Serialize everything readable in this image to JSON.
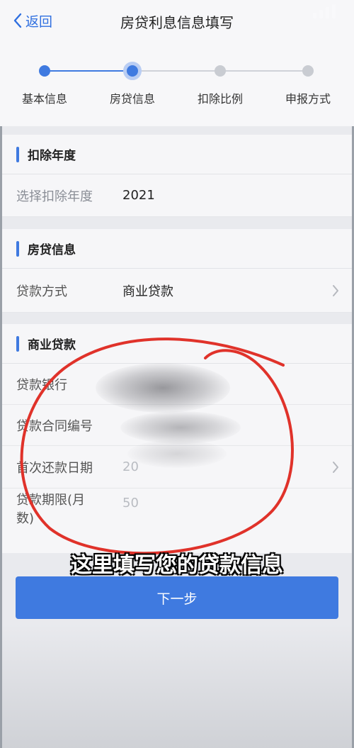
{
  "header": {
    "back_label": "返回",
    "title": "房贷利息信息填写"
  },
  "steps": [
    {
      "label": "基本信息",
      "state": "done"
    },
    {
      "label": "房贷信息",
      "state": "current"
    },
    {
      "label": "扣除比例",
      "state": "todo"
    },
    {
      "label": "申报方式",
      "state": "todo"
    }
  ],
  "section_year": {
    "title": "扣除年度",
    "field_label": "选择扣除年度",
    "field_value": "2021"
  },
  "section_loan": {
    "title": "房贷信息",
    "field_label": "贷款方式",
    "field_value": "商业贷款"
  },
  "section_commercial": {
    "title": "商业贷款",
    "rows": [
      {
        "label": "贷款银行",
        "value": ""
      },
      {
        "label": "贷款合同编号",
        "value": ""
      },
      {
        "label": "首次还款日期",
        "value": "20"
      },
      {
        "label": "贷款期限(月数)",
        "value": "50"
      }
    ]
  },
  "caption": "这里填写您的贷款信息",
  "next_button": "下一步",
  "colors": {
    "accent": "#3f7ae0",
    "annotation_circle": "#e0322a"
  }
}
